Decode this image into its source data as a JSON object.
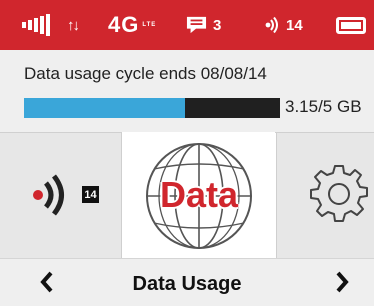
{
  "status_bar": {
    "network": "4G",
    "network_sub": "LTE",
    "messages_count": "3",
    "connected_devices": "14",
    "battery_level": 1.0,
    "color": "#d0262d"
  },
  "usage": {
    "cycle_text": "Data usage cycle ends 08/08/14",
    "amount_text": "3.15/5 GB",
    "used_fraction": 0.63,
    "bar_color": "#3aa6d9"
  },
  "tiles": {
    "wifi_clients": "14",
    "data_label": "Data"
  },
  "footer": {
    "page_title": "Data Usage"
  }
}
